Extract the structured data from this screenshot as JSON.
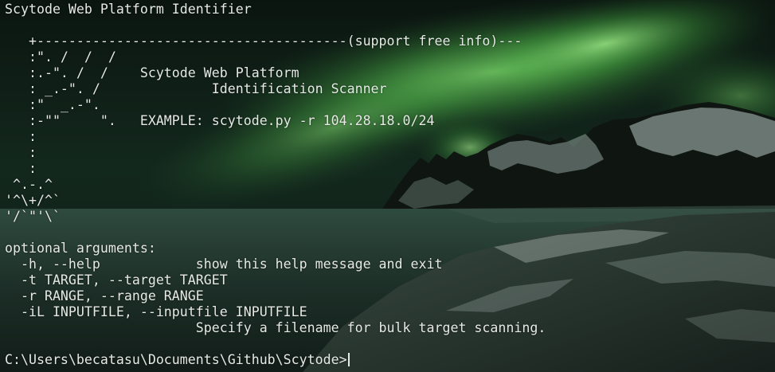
{
  "window": {
    "title": "Scytode Web Platform Identifier"
  },
  "colors": {
    "text": "#e6e9e6",
    "aurora": "#7fe06a",
    "sky": "#10201a",
    "mountains": "#0f1612",
    "snow": "#c7d4cc",
    "water": "#243a32",
    "cursor": "#e6e9e6"
  },
  "terminal": {
    "lines": [
      "Scytode Web Platform Identifier",
      "",
      "   +---------------------------------------(support free info)---",
      "   :\". /  /  /",
      "   :.-\". /  /    Scytode Web Platform",
      "   : _.-\". /              Identification Scanner",
      "   :\"  _.-\".",
      "   :-\"\"     \".   EXAMPLE: scytode.py -r 104.28.18.0/24",
      "   :",
      "   :",
      "   :",
      " ^.-.^",
      "'^\\+/^`",
      "'/`\"'\\`",
      "",
      "optional arguments:",
      "  -h, --help            show this help message and exit",
      "  -t TARGET, --target TARGET",
      "  -r RANGE, --range RANGE",
      "  -iL INPUTFILE, --inputfile INPUTFILE",
      "                        Specify a filename for bulk target scanning.",
      "",
      "C:\\Users\\becatasu\\Documents\\Github\\Scytode>"
    ]
  }
}
